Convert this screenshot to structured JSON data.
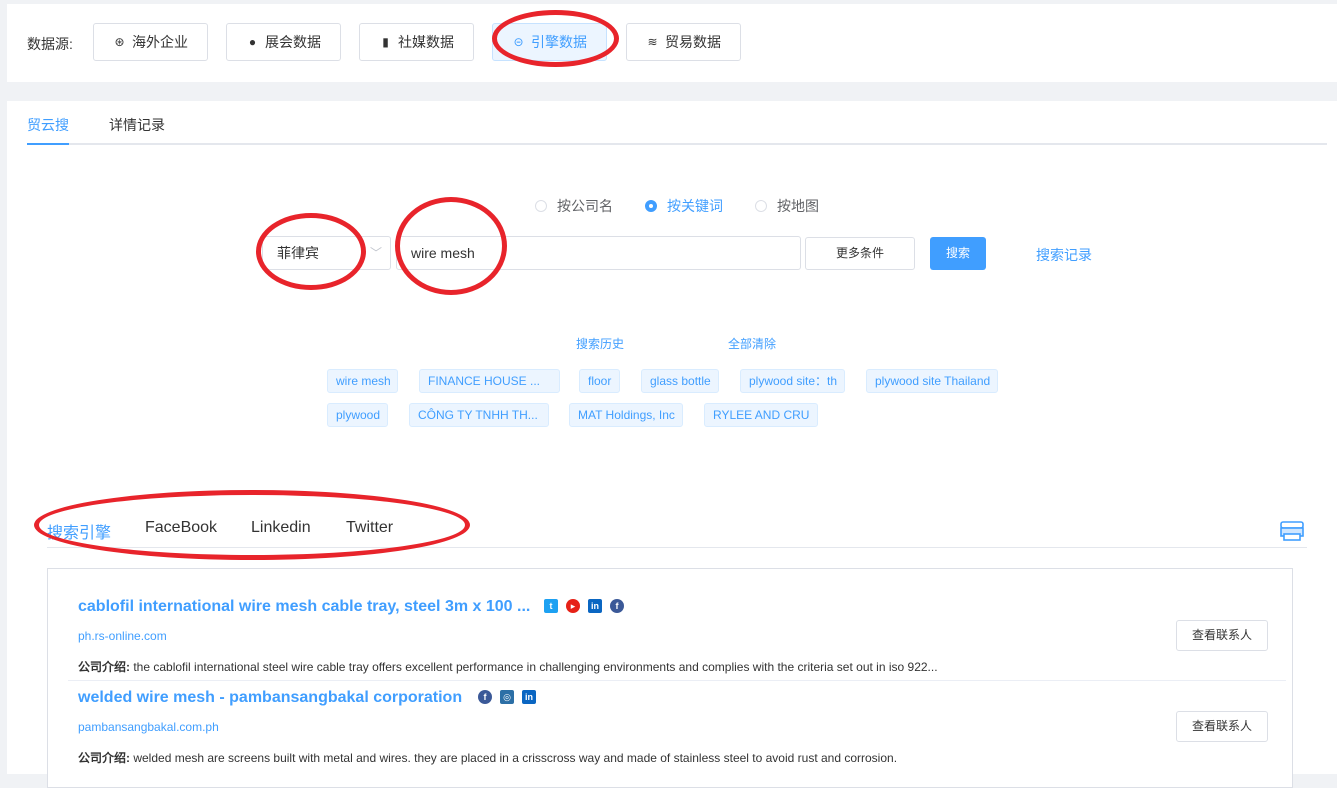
{
  "source_bar": {
    "label": "数据源:",
    "buttons": [
      {
        "label": "海外企业",
        "icon": "globe-icon"
      },
      {
        "label": "展会数据",
        "icon": "person-icon"
      },
      {
        "label": "社媒数据",
        "icon": "book-icon"
      },
      {
        "label": "引擎数据",
        "icon": "engine-icon",
        "active": true
      },
      {
        "label": "贸易数据",
        "icon": "stack-icon"
      }
    ]
  },
  "tabs": [
    {
      "label": "贸云搜",
      "active": true
    },
    {
      "label": "详情记录"
    }
  ],
  "search_mode": {
    "options": [
      {
        "label": "按公司名",
        "checked": false
      },
      {
        "label": "按关键词",
        "checked": true
      },
      {
        "label": "按地图",
        "checked": false
      }
    ]
  },
  "search": {
    "country": "菲律宾",
    "keyword": "wire mesh",
    "more_label": "更多条件",
    "search_label": "搜索",
    "records_label": "搜索记录"
  },
  "history": {
    "title": "搜索历史",
    "clear_label": "全部清除",
    "tags": [
      "wire mesh",
      "FINANCE HOUSE ...",
      "floor",
      "glass bottle",
      "plywood site：th",
      "plywood site Thailand",
      "plywood",
      "CÔNG TY TNHH TH...",
      "MAT Holdings, Inc",
      "RYLEE AND CRU"
    ]
  },
  "engine_tabs": [
    {
      "label": "搜索引擎",
      "active": true
    },
    {
      "label": "FaceBook"
    },
    {
      "label": "Linkedin"
    },
    {
      "label": "Twitter"
    }
  ],
  "results": [
    {
      "title": "cablofil international wire mesh cable tray, steel 3m x 100 ...",
      "url": "ph.rs-online.com",
      "desc_label": "公司介绍:",
      "desc": " the cablofil international steel wire cable tray offers excellent performance in challenging environments and complies with the criteria set out in iso 922...",
      "socials": [
        "twitter-icon",
        "youtube-icon",
        "linkedin-icon",
        "facebook-icon"
      ],
      "contact_label": "查看联系人"
    },
    {
      "title": "welded wire mesh - pambansangbakal corporation",
      "url": "pambansangbakal.com.ph",
      "desc_label": "公司介绍:",
      "desc": " welded mesh are screens built with metal and wires. they are placed in a crisscross way and made of stainless steel to avoid rust and corrosion.",
      "socials": [
        "facebook-icon",
        "instagram-icon",
        "linkedin-icon"
      ],
      "contact_label": "查看联系人"
    }
  ],
  "colors": {
    "accent": "#409eff",
    "annotation": "#e8242b"
  }
}
